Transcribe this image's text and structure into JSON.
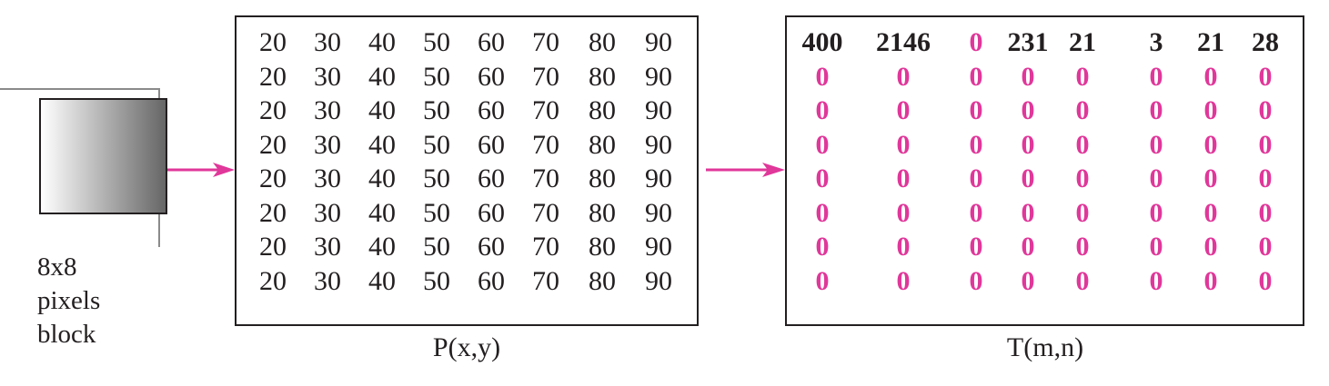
{
  "colors": {
    "ink": "#231f20",
    "accent": "#e0379a",
    "gradient_light": "#ffffff",
    "gradient_dark": "#666666"
  },
  "block": {
    "caption_lines": [
      "8x8",
      "pixels",
      "block"
    ]
  },
  "pixel_matrix": {
    "caption": "P(x,y)",
    "rows": [
      [
        "20",
        "30",
        "40",
        "50",
        "60",
        "70",
        "80",
        "90"
      ],
      [
        "20",
        "30",
        "40",
        "50",
        "60",
        "70",
        "80",
        "90"
      ],
      [
        "20",
        "30",
        "40",
        "50",
        "60",
        "70",
        "80",
        "90"
      ],
      [
        "20",
        "30",
        "40",
        "50",
        "60",
        "70",
        "80",
        "90"
      ],
      [
        "20",
        "30",
        "40",
        "50",
        "60",
        "70",
        "80",
        "90"
      ],
      [
        "20",
        "30",
        "40",
        "50",
        "60",
        "70",
        "80",
        "90"
      ],
      [
        "20",
        "30",
        "40",
        "50",
        "60",
        "70",
        "80",
        "90"
      ],
      [
        "20",
        "30",
        "40",
        "50",
        "60",
        "70",
        "80",
        "90"
      ]
    ]
  },
  "transform_matrix": {
    "caption": "T(m,n)",
    "rows": [
      [
        {
          "v": "400",
          "hl": false
        },
        {
          "v": "2146",
          "hl": false
        },
        {
          "v": "0",
          "hl": true
        },
        {
          "v": "231",
          "hl": false
        },
        {
          "v": "21",
          "hl": false
        },
        {
          "v": "3",
          "hl": false
        },
        {
          "v": "21",
          "hl": false
        },
        {
          "v": "28",
          "hl": false
        }
      ],
      [
        {
          "v": "0",
          "hl": true
        },
        {
          "v": "0",
          "hl": true
        },
        {
          "v": "0",
          "hl": true
        },
        {
          "v": "0",
          "hl": true
        },
        {
          "v": "0",
          "hl": true
        },
        {
          "v": "0",
          "hl": true
        },
        {
          "v": "0",
          "hl": true
        },
        {
          "v": "0",
          "hl": true
        }
      ],
      [
        {
          "v": "0",
          "hl": true
        },
        {
          "v": "0",
          "hl": true
        },
        {
          "v": "0",
          "hl": true
        },
        {
          "v": "0",
          "hl": true
        },
        {
          "v": "0",
          "hl": true
        },
        {
          "v": "0",
          "hl": true
        },
        {
          "v": "0",
          "hl": true
        },
        {
          "v": "0",
          "hl": true
        }
      ],
      [
        {
          "v": "0",
          "hl": true
        },
        {
          "v": "0",
          "hl": true
        },
        {
          "v": "0",
          "hl": true
        },
        {
          "v": "0",
          "hl": true
        },
        {
          "v": "0",
          "hl": true
        },
        {
          "v": "0",
          "hl": true
        },
        {
          "v": "0",
          "hl": true
        },
        {
          "v": "0",
          "hl": true
        }
      ],
      [
        {
          "v": "0",
          "hl": true
        },
        {
          "v": "0",
          "hl": true
        },
        {
          "v": "0",
          "hl": true
        },
        {
          "v": "0",
          "hl": true
        },
        {
          "v": "0",
          "hl": true
        },
        {
          "v": "0",
          "hl": true
        },
        {
          "v": "0",
          "hl": true
        },
        {
          "v": "0",
          "hl": true
        }
      ],
      [
        {
          "v": "0",
          "hl": true
        },
        {
          "v": "0",
          "hl": true
        },
        {
          "v": "0",
          "hl": true
        },
        {
          "v": "0",
          "hl": true
        },
        {
          "v": "0",
          "hl": true
        },
        {
          "v": "0",
          "hl": true
        },
        {
          "v": "0",
          "hl": true
        },
        {
          "v": "0",
          "hl": true
        }
      ],
      [
        {
          "v": "0",
          "hl": true
        },
        {
          "v": "0",
          "hl": true
        },
        {
          "v": "0",
          "hl": true
        },
        {
          "v": "0",
          "hl": true
        },
        {
          "v": "0",
          "hl": true
        },
        {
          "v": "0",
          "hl": true
        },
        {
          "v": "0",
          "hl": true
        },
        {
          "v": "0",
          "hl": true
        }
      ],
      [
        {
          "v": "0",
          "hl": true
        },
        {
          "v": "0",
          "hl": true
        },
        {
          "v": "0",
          "hl": true
        },
        {
          "v": "0",
          "hl": true
        },
        {
          "v": "0",
          "hl": true
        },
        {
          "v": "0",
          "hl": true
        },
        {
          "v": "0",
          "hl": true
        },
        {
          "v": "0",
          "hl": true
        }
      ]
    ]
  }
}
